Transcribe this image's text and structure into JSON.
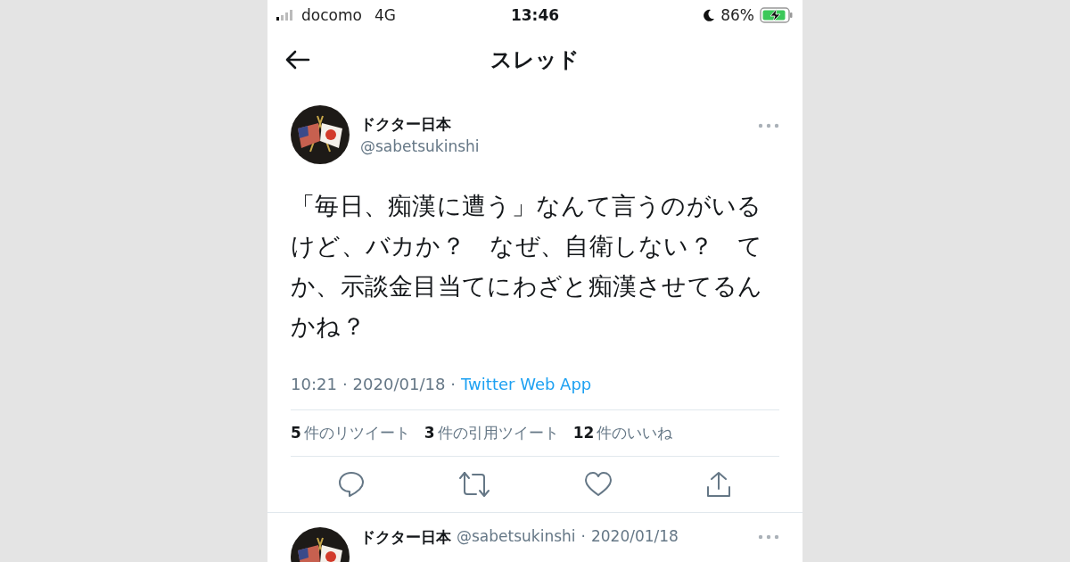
{
  "status_bar": {
    "carrier": "docomo",
    "network": "4G",
    "time": "13:46",
    "battery": "86%"
  },
  "header": {
    "title": "スレッド"
  },
  "tweet": {
    "display_name": "ドクター日本",
    "handle": "@sabetsukinshi",
    "text": "「毎日、痴漢に遭う」なんて言うのがいるけど、バカか？　なぜ、自衛しない？　てか、示談金目当てにわざと痴漢させてるんかね？",
    "time": "10:21",
    "separator": "·",
    "date": "2020/01/18",
    "source": "Twitter Web App",
    "stats": [
      {
        "count": "5",
        "label": "件のリツイート"
      },
      {
        "count": "3",
        "label": "件の引用ツイート"
      },
      {
        "count": "12",
        "label": "件のいいね"
      }
    ]
  },
  "reply": {
    "display_name": "ドクター日本",
    "handle": "@sabetsukinshi",
    "separator": "·",
    "date": "2020/01/18"
  }
}
